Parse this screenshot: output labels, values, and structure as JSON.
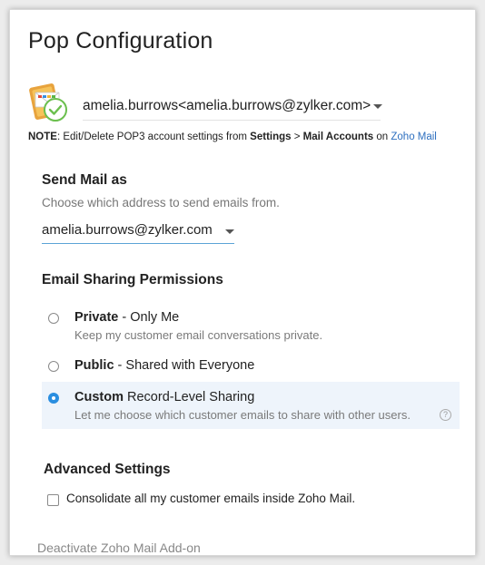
{
  "header": {
    "title": "Pop Configuration"
  },
  "account": {
    "selected": "amelia.burrows<amelia.burrows@zylker.com>",
    "logo_icon": "envelope-with-check-icon"
  },
  "note": {
    "prefix": "NOTE",
    "text1": ": Edit/Delete POP3 account settings from ",
    "settings": "Settings",
    "sep": " > ",
    "mail_accounts": "Mail Accounts",
    "text2": " on ",
    "link": "Zoho Mail",
    "link_color": "#2d6fbf"
  },
  "send_mail": {
    "title": "Send Mail as",
    "subtitle": "Choose which address to send emails from.",
    "selected": "amelia.burrows@zylker.com"
  },
  "sharing": {
    "title": "Email Sharing Permissions",
    "options": [
      {
        "bold": "Private",
        "rest": " - Only Me",
        "desc": "Keep my customer email conversations private.",
        "selected": false
      },
      {
        "bold": "Public",
        "rest": " - Shared with Everyone",
        "desc": "",
        "selected": false
      },
      {
        "bold": "Custom",
        "rest": " Record-Level Sharing",
        "desc": "Let me choose which customer emails to share with other users.",
        "selected": true
      }
    ],
    "help_icon": "?",
    "accent": "#2a8ee0"
  },
  "advanced": {
    "title": "Advanced Settings",
    "consolidate_label": "Consolidate all my customer emails inside Zoho Mail.",
    "consolidate_checked": false
  },
  "footer": {
    "deactivate": "Deactivate Zoho Mail Add-on"
  }
}
